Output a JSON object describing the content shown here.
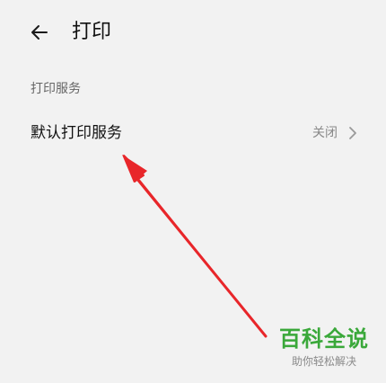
{
  "header": {
    "title": "打印",
    "back_icon": "arrow-left-icon"
  },
  "section": {
    "title": "打印服务"
  },
  "settings": [
    {
      "label": "默认打印服务",
      "value": "关闭",
      "icon": "chevron-right-icon"
    }
  ],
  "colors": {
    "background": "#f2f2f2",
    "annotation_arrow": "#e8262a",
    "watermark": "#3aa83a"
  },
  "watermark": {
    "title": "百科全说",
    "subtitle": "助你轻松解决"
  }
}
